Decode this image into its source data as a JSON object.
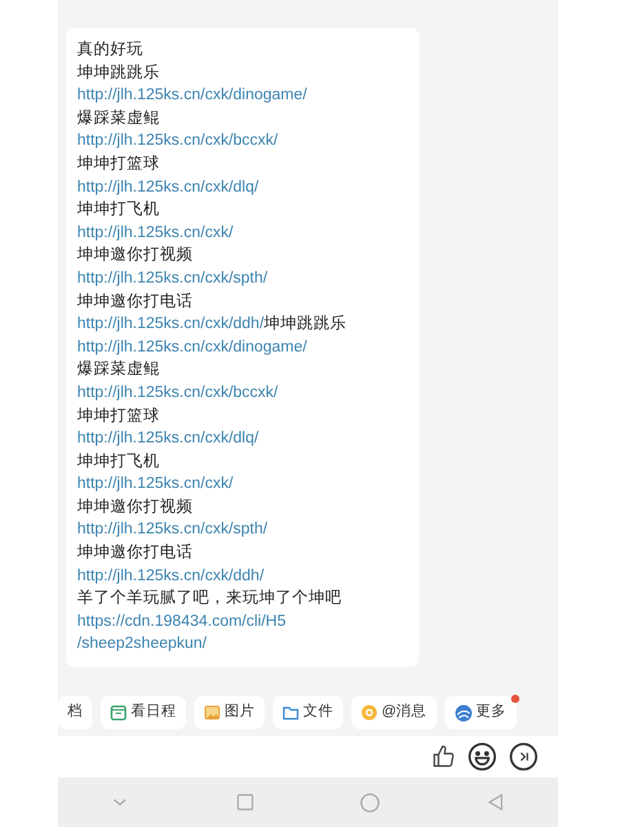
{
  "message": {
    "lines": [
      [
        {
          "kind": "text",
          "text": "真的好玩"
        }
      ],
      [
        {
          "kind": "text",
          "text": "坤坤跳跳乐"
        }
      ],
      [
        {
          "kind": "link",
          "text": "http://jlh.125ks.cn/cxk/dinogame/"
        }
      ],
      [
        {
          "kind": "text",
          "text": "爆踩菜虚鲲"
        }
      ],
      [
        {
          "kind": "link",
          "text": "http://jlh.125ks.cn/cxk/bccxk/"
        }
      ],
      [
        {
          "kind": "text",
          "text": "坤坤打篮球"
        }
      ],
      [
        {
          "kind": "link",
          "text": "http://jlh.125ks.cn/cxk/dlq/"
        }
      ],
      [
        {
          "kind": "text",
          "text": "坤坤打飞机"
        }
      ],
      [
        {
          "kind": "link",
          "text": "http://jlh.125ks.cn/cxk/"
        }
      ],
      [
        {
          "kind": "text",
          "text": "坤坤邀你打视频"
        }
      ],
      [
        {
          "kind": "link",
          "text": "http://jlh.125ks.cn/cxk/spth/"
        }
      ],
      [
        {
          "kind": "text",
          "text": "坤坤邀你打电话"
        }
      ],
      [
        {
          "kind": "link",
          "text": "http://jlh.125ks.cn/cxk/ddh/"
        },
        {
          "kind": "text",
          "text": "坤坤跳跳乐"
        }
      ],
      [
        {
          "kind": "link",
          "text": "http://jlh.125ks.cn/cxk/dinogame/"
        }
      ],
      [
        {
          "kind": "text",
          "text": "爆踩菜虚鲲"
        }
      ],
      [
        {
          "kind": "link",
          "text": "http://jlh.125ks.cn/cxk/bccxk/"
        }
      ],
      [
        {
          "kind": "text",
          "text": "坤坤打篮球"
        }
      ],
      [
        {
          "kind": "link",
          "text": "http://jlh.125ks.cn/cxk/dlq/"
        }
      ],
      [
        {
          "kind": "text",
          "text": "坤坤打飞机"
        }
      ],
      [
        {
          "kind": "link",
          "text": "http://jlh.125ks.cn/cxk/"
        }
      ],
      [
        {
          "kind": "text",
          "text": "坤坤邀你打视频"
        }
      ],
      [
        {
          "kind": "link",
          "text": "http://jlh.125ks.cn/cxk/spth/"
        }
      ],
      [
        {
          "kind": "text",
          "text": "坤坤邀你打电话"
        }
      ],
      [
        {
          "kind": "link",
          "text": "http://jlh.125ks.cn/cxk/ddh/"
        }
      ],
      [
        {
          "kind": "text",
          "text": "羊了个羊玩腻了吧，来玩坤了个坤吧"
        }
      ],
      [
        {
          "kind": "link",
          "text": "https://cdn.198434.com/cli/H5"
        }
      ],
      [
        {
          "kind": "link",
          "text": "/sheep2sheepkun/"
        }
      ]
    ]
  },
  "shortcuts": [
    {
      "kind": "doc",
      "label": "档",
      "badge": false
    },
    {
      "kind": "calendar",
      "label": "看日程",
      "badge": false
    },
    {
      "kind": "image",
      "label": "图片",
      "badge": false
    },
    {
      "kind": "folder",
      "label": "文件",
      "badge": false
    },
    {
      "kind": "mention",
      "label": "@消息",
      "badge": false
    },
    {
      "kind": "more",
      "label": "更多",
      "badge": true
    }
  ]
}
